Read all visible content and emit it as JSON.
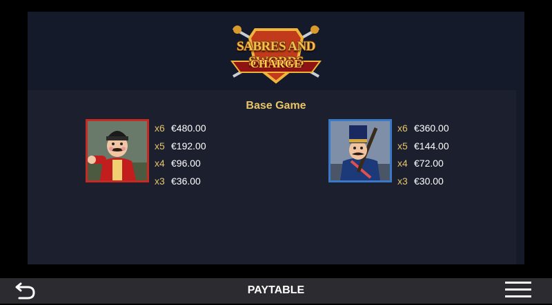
{
  "header": {
    "logo": {
      "title": "SABRES AND SWORDS",
      "subtitle": "CHARGE"
    }
  },
  "section": {
    "title": "Base Game"
  },
  "symbols": [
    {
      "icon": "red-soldier-icon",
      "color": "#c62a22",
      "payouts": [
        {
          "mult": "x6",
          "amount": "€480.00"
        },
        {
          "mult": "x5",
          "amount": "€192.00"
        },
        {
          "mult": "x4",
          "amount": "€96.00"
        },
        {
          "mult": "x3",
          "amount": "€36.00"
        }
      ]
    },
    {
      "icon": "blue-soldier-icon",
      "color": "#3a78c8",
      "payouts": [
        {
          "mult": "x6",
          "amount": "€360.00"
        },
        {
          "mult": "x5",
          "amount": "€144.00"
        },
        {
          "mult": "x4",
          "amount": "€72.00"
        },
        {
          "mult": "x3",
          "amount": "€30.00"
        }
      ]
    }
  ],
  "bottom_bar": {
    "title": "PAYTABLE",
    "back_icon": "back-arrow-icon",
    "menu_icon": "hamburger-menu-icon"
  }
}
